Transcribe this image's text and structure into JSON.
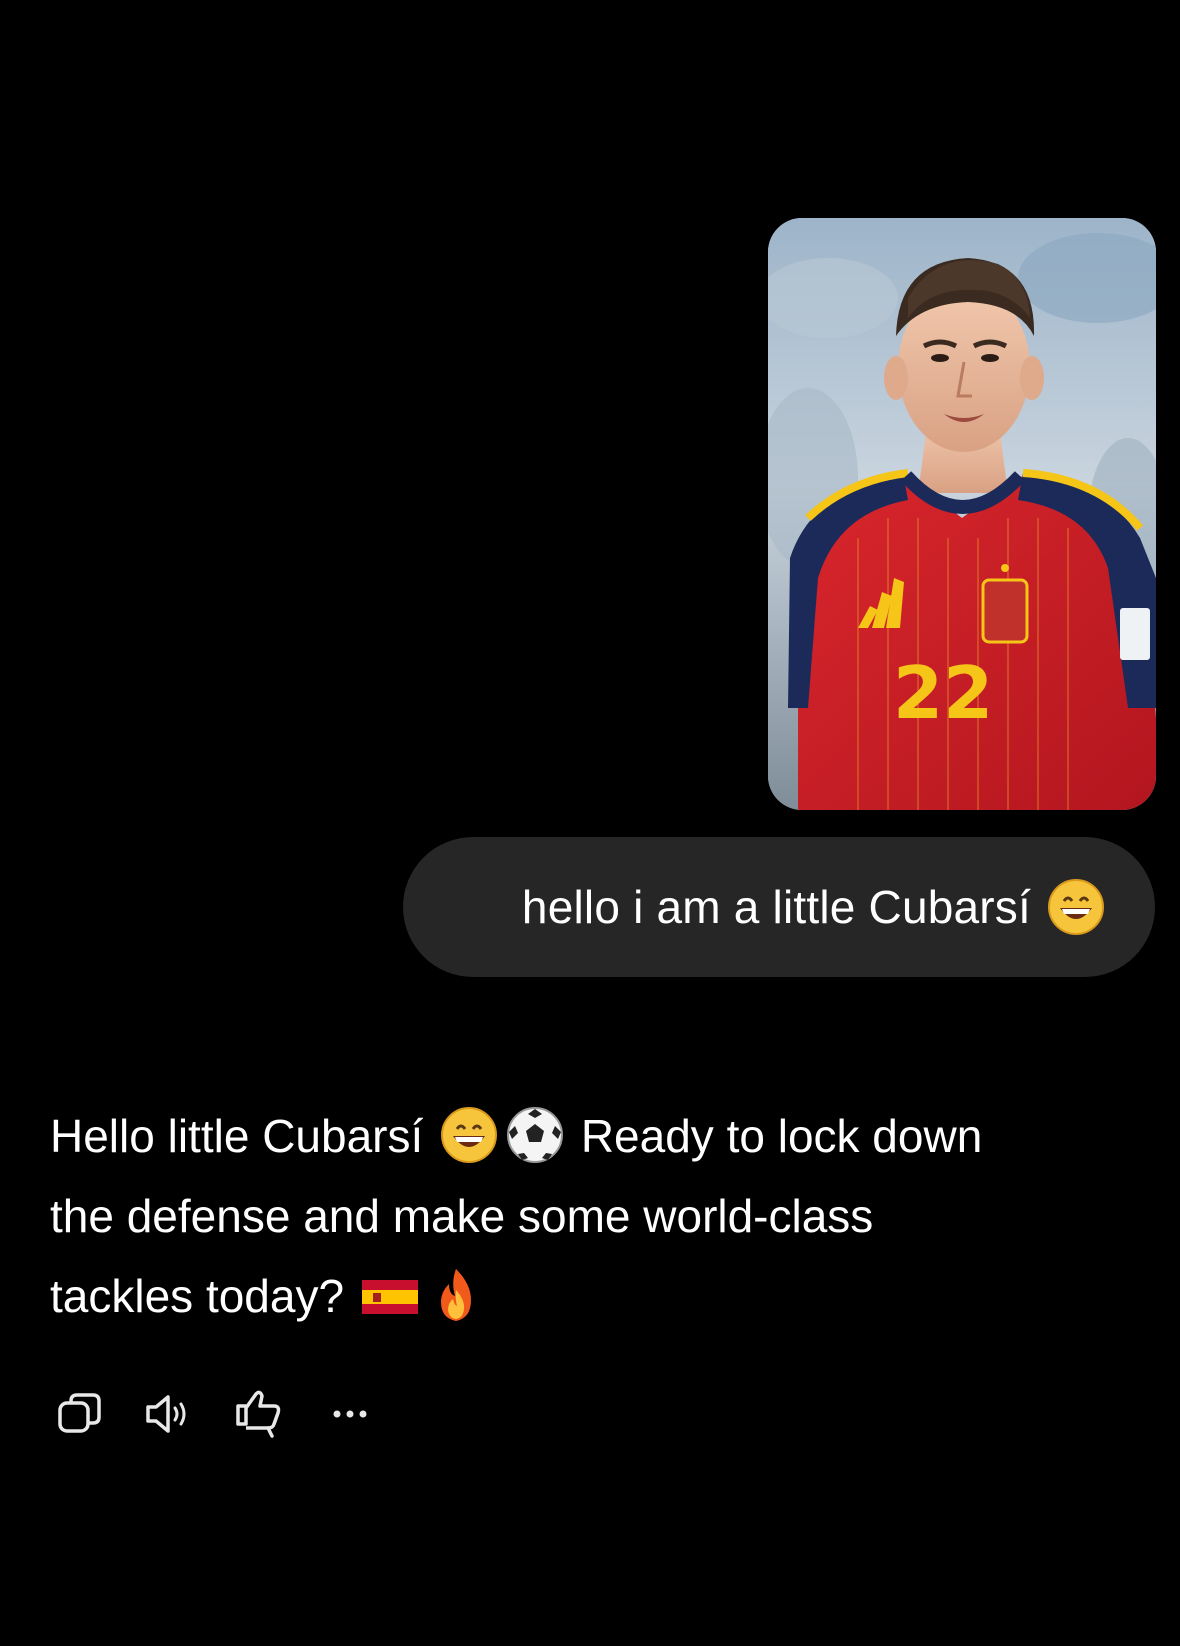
{
  "conversation": {
    "user_image_alt": "Football player in red Spain jersey number 22",
    "user_message": {
      "text": "hello i am a little Cubarsí",
      "emoji": "grinning-face"
    },
    "assistant_message": {
      "segments": [
        {
          "type": "text",
          "value": "Hello little Cubarsí"
        },
        {
          "type": "emoji",
          "name": "grinning-face"
        },
        {
          "type": "emoji",
          "name": "soccer-ball"
        },
        {
          "type": "text",
          "value": "Ready to lock down"
        },
        {
          "type": "text",
          "value": "the defense and make some world-class"
        },
        {
          "type": "text",
          "value": "tackles today?"
        },
        {
          "type": "emoji",
          "name": "spain-flag"
        },
        {
          "type": "emoji",
          "name": "fire"
        }
      ],
      "line1_text_a": "Hello little Cubarsí ",
      "line1_text_b": " Ready to lock down",
      "line2_text": "the defense and make some world-class",
      "line3_text": "tackles today? "
    },
    "actions": [
      {
        "name": "copy",
        "icon": "copy-icon"
      },
      {
        "name": "read-aloud",
        "icon": "speaker-icon"
      },
      {
        "name": "dislike",
        "icon": "thumbs-down-icon"
      },
      {
        "name": "more",
        "icon": "more-dots-icon"
      }
    ]
  },
  "colors": {
    "background": "#000000",
    "user_bubble": "#262626",
    "text": "#ffffff",
    "icon": "#e8e8e8"
  }
}
